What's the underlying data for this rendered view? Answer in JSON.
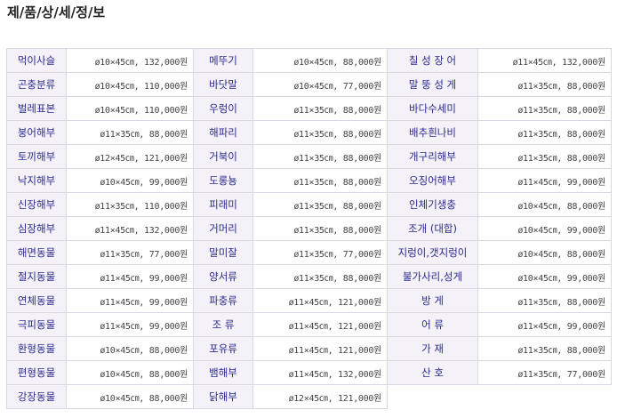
{
  "page": {
    "title": "제/품/상/세/정/보"
  },
  "table": {
    "rows": [
      [
        {
          "name": "먹이사슬",
          "spec": "ø10×45㎝, 132,000원"
        },
        {
          "name": "메뚜기",
          "spec": "ø10×45㎝,  88,000원"
        },
        {
          "name": "칠 성 장 어",
          "spec": "ø11×45㎝, 132,000원"
        }
      ],
      [
        {
          "name": "곤충분류",
          "spec": "ø10×45㎝, 110,000원"
        },
        {
          "name": "바닷말",
          "spec": "ø10×45㎝,  77,000원"
        },
        {
          "name": "말 뚱 성 게",
          "spec": "ø11×35㎝,  88,000원"
        }
      ],
      [
        {
          "name": "벌레표본",
          "spec": "ø10×45㎝, 110,000원"
        },
        {
          "name": "우렁이",
          "spec": "ø11×35㎝,  88,000원"
        },
        {
          "name": "바다수세미",
          "spec": "ø11×35㎝,  88,000원"
        }
      ],
      [
        {
          "name": "붕어해부",
          "spec": "ø11×35㎝,  88,000원"
        },
        {
          "name": "해파리",
          "spec": "ø11×35㎝,  88,000원"
        },
        {
          "name": "배추흰나비",
          "spec": "ø11×35㎝,  88,000원"
        }
      ],
      [
        {
          "name": "토끼해부",
          "spec": "ø12×45㎝, 121,000원"
        },
        {
          "name": "거북이",
          "spec": "ø11×35㎝,  88,000원"
        },
        {
          "name": "개구리해부",
          "spec": "ø11×35㎝,  88,000원"
        }
      ],
      [
        {
          "name": "낙지해부",
          "spec": "ø10×45㎝,  99,000원"
        },
        {
          "name": "도롱뇽",
          "spec": "ø11×35㎝,  88,000원"
        },
        {
          "name": "오징어해부",
          "spec": "ø11×45㎝,  99,000원"
        }
      ],
      [
        {
          "name": "신장해부",
          "spec": "ø11×35㎝, 110,000원"
        },
        {
          "name": "피래미",
          "spec": "ø11×35㎝,  88,000원"
        },
        {
          "name": "인체기생충",
          "spec": "ø10×45㎝,  88,000원"
        }
      ],
      [
        {
          "name": "심장해부",
          "spec": "ø11×45㎝, 132,000원"
        },
        {
          "name": "거머리",
          "spec": "ø11×35㎝,  88,000원"
        },
        {
          "name": "조개 (대합)",
          "spec": "ø10×45㎝,  99,000원"
        }
      ],
      [
        {
          "name": "해면동물",
          "spec": "ø11×35㎝,  77,000원"
        },
        {
          "name": "말미잘",
          "spec": "ø11×35㎝,  77,000원"
        },
        {
          "name": "지렁이,갯지렁이",
          "spec": "ø10×45㎝,  88,000원"
        }
      ],
      [
        {
          "name": "절지동물",
          "spec": "ø11×45㎝,  99,000원"
        },
        {
          "name": "양서류",
          "spec": "ø11×35㎝,  88,000원"
        },
        {
          "name": "불가사리,성게",
          "spec": "ø10×45㎝,  99,000원"
        }
      ],
      [
        {
          "name": "연체동물",
          "spec": "ø11×45㎝,  99,000원"
        },
        {
          "name": "파충류",
          "spec": "ø11×45㎝, 121,000원"
        },
        {
          "name": "방   게",
          "spec": "ø11×35㎝,  88,000원"
        }
      ],
      [
        {
          "name": "극피동물",
          "spec": "ø11×45㎝,  99,000원"
        },
        {
          "name": "조   류",
          "spec": "ø11×45㎝, 121,000원"
        },
        {
          "name": "어   류",
          "spec": "ø11×45㎝,  99,000원"
        }
      ],
      [
        {
          "name": "환형동물",
          "spec": "ø10×45㎝,  88,000원"
        },
        {
          "name": "포유류",
          "spec": "ø11×45㎝, 121,000원"
        },
        {
          "name": "가   재",
          "spec": "ø11×35㎝,  88,000원"
        }
      ],
      [
        {
          "name": "편형동물",
          "spec": "ø10×45㎝,  88,000원"
        },
        {
          "name": "뱀해부",
          "spec": "ø11×45㎝, 132,000원"
        },
        {
          "name": "산   호",
          "spec": "ø11×35㎝,  77,000원"
        }
      ],
      [
        {
          "name": "강장동물",
          "spec": "ø10×45㎝,  88,000원"
        },
        {
          "name": "닭해부",
          "spec": "ø12×45㎝, 121,000원"
        },
        {
          "name": "",
          "spec": ""
        }
      ]
    ]
  }
}
